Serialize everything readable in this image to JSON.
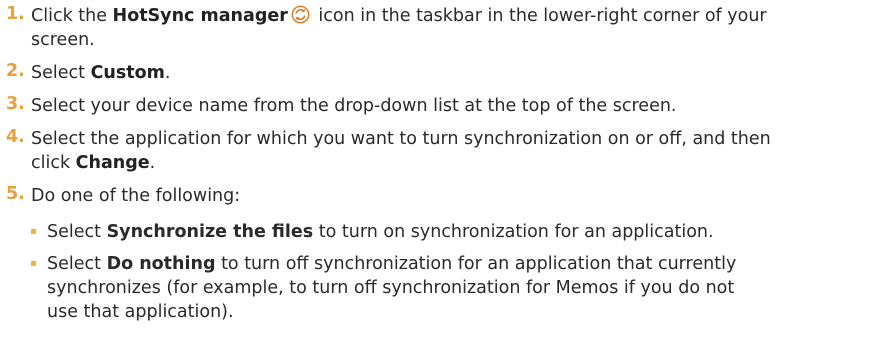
{
  "steps": [
    {
      "number": "1.",
      "before": "Click the ",
      "bold": "HotSync manager",
      "icon": "hotsync-icon",
      "after": " icon in the taskbar in the lower-right corner of your",
      "line2": "screen."
    },
    {
      "number": "2.",
      "before": "Select ",
      "bold": "Custom",
      "after": "."
    },
    {
      "number": "3.",
      "text": "Select your device name from the drop-down list at the top of the screen."
    },
    {
      "number": "4.",
      "line1": "Select the application for which you want to turn synchronization on or off, and then",
      "before": "click ",
      "bold": "Change",
      "after": "."
    },
    {
      "number": "5.",
      "text": "Do one of the following:"
    }
  ],
  "bullets": [
    {
      "before": "Select ",
      "bold": "Synchronize the files",
      "after": " to turn on synchronization for an application."
    },
    {
      "before": "Select ",
      "bold": "Do nothing",
      "after": " to turn off synchronization for an application that currently",
      "line2": "synchronizes (for example, to turn off synchronization for Memos if you do not",
      "line3": "use that application)."
    }
  ],
  "colors": {
    "accent": "#e8a13a",
    "text": "#2a2a2a"
  }
}
